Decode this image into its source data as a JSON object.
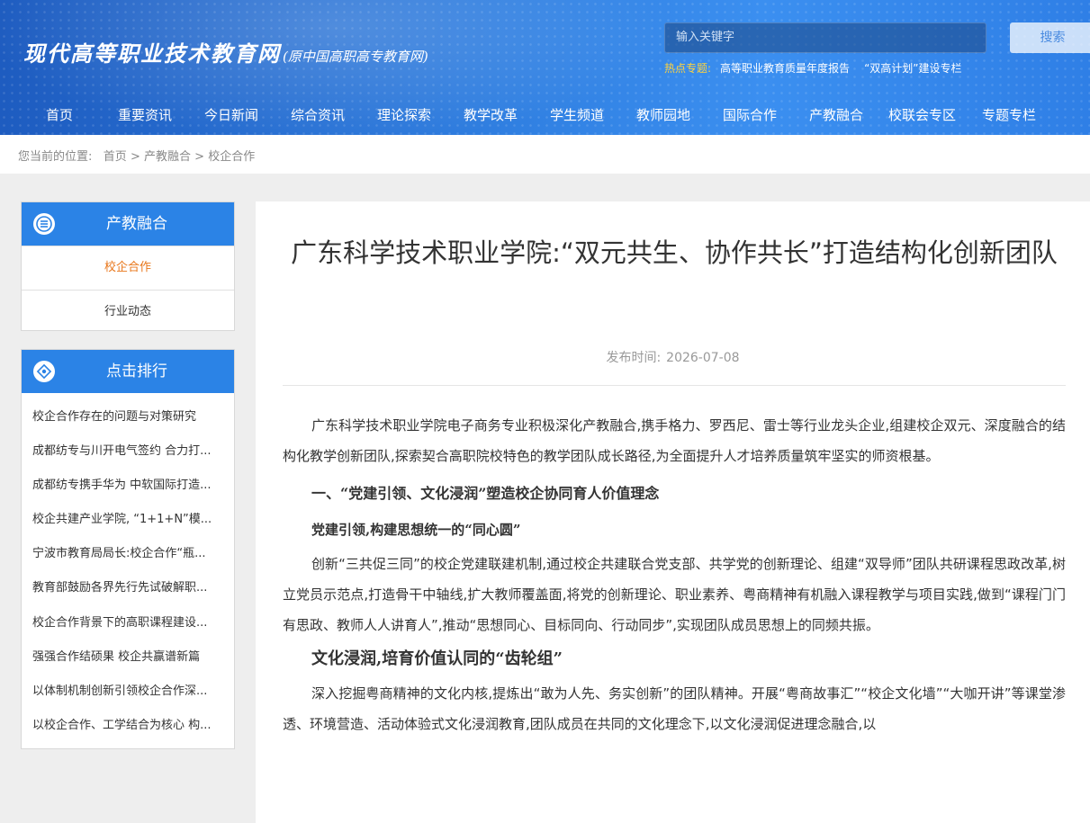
{
  "header": {
    "logo_main": "现代高等职业技术教育网",
    "logo_sub": "(原中国高职高专教育网)",
    "search_placeholder": "输入关键字",
    "search_button": "搜索",
    "hot_label": "热点专题:",
    "hot_items": [
      "高等职业教育质量年度报告",
      "“双高计划”建设专栏"
    ]
  },
  "nav": [
    "首页",
    "重要资讯",
    "今日新闻",
    "综合资讯",
    "理论探索",
    "教学改革",
    "学生频道",
    "教师园地",
    "国际合作",
    "产教融合",
    "校联会专区",
    "专题专栏"
  ],
  "breadcrumb": {
    "prefix": "您当前的位置:",
    "items": [
      "首页",
      "产教融合",
      "校企合作"
    ],
    "sep": ">"
  },
  "sidebar": {
    "category_title": "产教融合",
    "category_items": [
      "校企合作",
      "行业动态"
    ],
    "ranking_title": "点击排行",
    "ranking_items": [
      "校企合作存在的问题与对策研究",
      "成都纺专与川开电气签约 合力打...",
      "成都纺专携手华为 中软国际打造...",
      "校企共建产业学院, “1+1+N”模...",
      "宁波市教育局局长:校企合作“瓶...",
      "教育部鼓励各界先行先试破解职...",
      "校企合作背景下的高职课程建设...",
      "强强合作结硕果 校企共赢谱新篇",
      "以体制机制创新引领校企合作深...",
      "以校企合作、工学结合为核心 构..."
    ]
  },
  "article": {
    "title": "广东科学技术职业学院:“双元共生、协作共长”打造结构化创新团队",
    "date_label": "发布时间:",
    "date": "2026-07-08",
    "p1": "广东科学技术职业学院电子商务专业积极深化产教融合,携手格力、罗西尼、雷士等行业龙头企业,组建校企双元、深度融合的结构化教学创新团队,探索契合高职院校特色的教学团队成长路径,为全面提升人才培养质量筑牢坚实的师资根基。",
    "h1": "一、“党建引领、文化浸润”塑造校企协同育人价值理念",
    "h1a": "党建引领,构建思想统一的“同心圆”",
    "p2": "创新“三共促三同”的校企党建联建机制,通过校企共建联合党支部、共学党的创新理论、组建“双导师”团队共研课程思政改革,树立党员示范点,打造骨干中轴线,扩大教师覆盖面,将党的创新理论、职业素养、粤商精神有机融入课程教学与项目实践,做到“课程门门有思政、教师人人讲育人”,推动“思想同心、目标同向、行动同步”,实现团队成员思想上的同频共振。",
    "h1b": "文化浸润,培育价值认同的“齿轮组”",
    "p3": "深入挖掘粤商精神的文化内核,提炼出“敢为人先、务实创新”的团队精神。开展“粤商故事汇”“校企文化墙”“大咖开讲”等课堂渗透、环境营造、活动体验式文化浸润教育,团队成员在共同的文化理念下,以文化浸润促进理念融合,以"
  },
  "colors": {
    "header_blue": "#2f7ee0",
    "sidebar_head": "#2b83e6",
    "active_orange": "#e8761a",
    "hot_yellow": "#ffd33d"
  }
}
